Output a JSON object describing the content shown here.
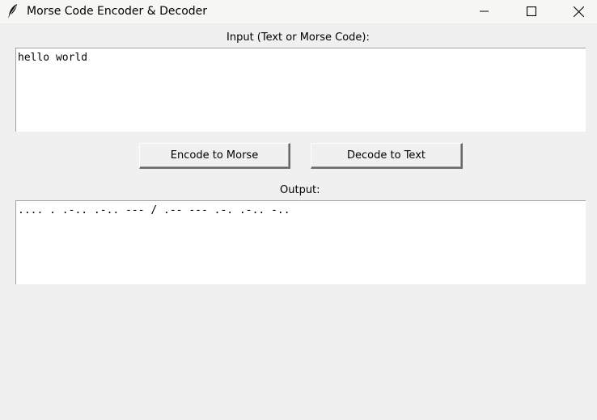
{
  "window": {
    "title": "Morse Code Encoder & Decoder",
    "icon": "feather-icon",
    "controls": [
      "minimize-icon",
      "maximize-icon",
      "close-icon"
    ]
  },
  "input": {
    "label": "Input (Text or Morse Code):",
    "value": "hello world"
  },
  "buttons": {
    "encode_label": "Encode to Morse",
    "decode_label": "Decode to Text"
  },
  "output": {
    "label": "Output:",
    "value": ".... . .-.. .-.. --- / .-- --- .-. .-.. -.."
  }
}
